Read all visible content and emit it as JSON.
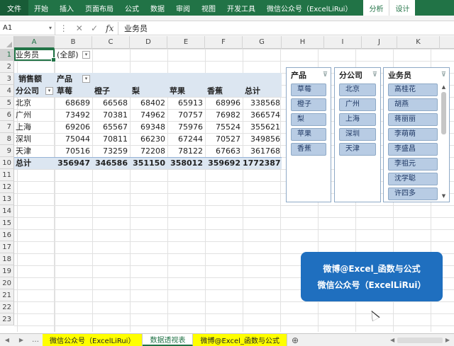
{
  "ribbon": {
    "tabs": [
      "文件",
      "开始",
      "插入",
      "页面布局",
      "公式",
      "数据",
      "审阅",
      "视图",
      "开发工具",
      "微信公众号（ExcelLiRui）"
    ],
    "context_tabs": [
      "分析",
      "设计"
    ]
  },
  "formula_bar": {
    "name_box": "A1",
    "content": "业务员"
  },
  "columns": [
    "A",
    "B",
    "C",
    "D",
    "E",
    "F",
    "G",
    "H",
    "I",
    "J",
    "K"
  ],
  "rows": [
    "1",
    "2",
    "3",
    "4",
    "5",
    "6",
    "7",
    "8",
    "9",
    "10",
    "11",
    "12",
    "13",
    "14",
    "15",
    "16",
    "17",
    "18",
    "19",
    "20",
    "21",
    "22",
    "23"
  ],
  "filter": {
    "label": "业务员",
    "value": "(全部)"
  },
  "pivot": {
    "data_label": "销售额",
    "col_field": "产品",
    "row_field": "分公司",
    "columns": [
      "草莓",
      "橙子",
      "梨",
      "苹果",
      "香蕉",
      "总计"
    ],
    "rows": [
      {
        "name": "北京",
        "values": [
          "68689",
          "66568",
          "68402",
          "65913",
          "68996",
          "338568"
        ]
      },
      {
        "name": "广州",
        "values": [
          "73492",
          "70381",
          "74962",
          "70757",
          "76982",
          "366574"
        ]
      },
      {
        "name": "上海",
        "values": [
          "69206",
          "65567",
          "69348",
          "75976",
          "75524",
          "355621"
        ]
      },
      {
        "name": "深圳",
        "values": [
          "75044",
          "70811",
          "66230",
          "67244",
          "70527",
          "349856"
        ]
      },
      {
        "name": "天津",
        "values": [
          "70516",
          "73259",
          "72208",
          "78122",
          "67663",
          "361768"
        ]
      }
    ],
    "total": {
      "name": "总计",
      "values": [
        "356947",
        "346586",
        "351150",
        "358012",
        "359692",
        "1772387"
      ]
    }
  },
  "slicers": {
    "product": {
      "title": "产品",
      "items": [
        "草莓",
        "橙子",
        "梨",
        "苹果",
        "香蕉"
      ]
    },
    "branch": {
      "title": "分公司",
      "items": [
        "北京",
        "广州",
        "上海",
        "深圳",
        "天津"
      ]
    },
    "salesperson": {
      "title": "业务员",
      "items": [
        "高桂花",
        "胡燕",
        "蒋丽丽",
        "李萌萌",
        "李盛昌",
        "李祖元",
        "沈学聪",
        "许四多"
      ]
    }
  },
  "callout": {
    "line1": "微博@Excel_函数与公式",
    "line2": "微信公众号（ExcelLiRui）"
  },
  "sheet_tabs": [
    "微信公众号（ExcelLiRui）",
    "数据透视表",
    "微博@Excel_函数与公式"
  ],
  "colors": {
    "ribbon": "#217346",
    "pivot_band": "#dce6f1",
    "slicer_item": "#b8cce4",
    "callout": "#1f6fbf",
    "tab_highlight": "#ffff00"
  }
}
